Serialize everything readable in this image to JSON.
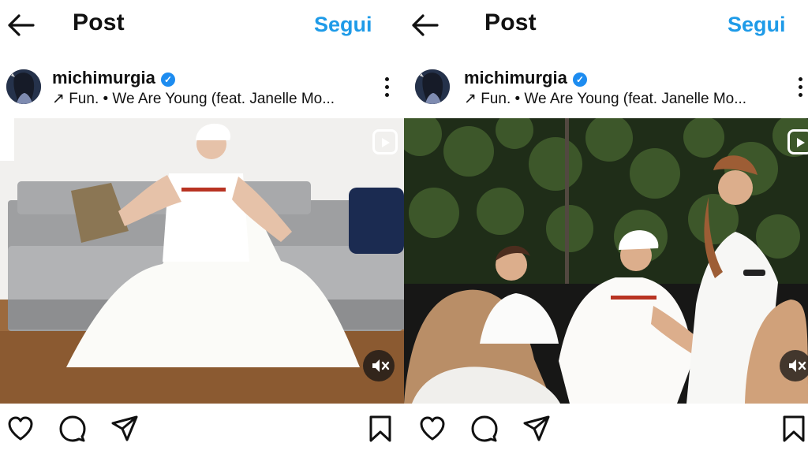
{
  "header": {
    "title": "Post",
    "follow_label": "Segui"
  },
  "post": {
    "username": "michimurgia",
    "music": "↗ Fun. • We Are Young (feat. Janelle Mo..."
  },
  "icons": [
    "back-arrow-icon",
    "verified-badge-icon",
    "more-options-icon",
    "reels-icon",
    "muted-audio-icon",
    "heart-icon",
    "comment-icon",
    "share-icon",
    "bookmark-icon"
  ],
  "colors": {
    "accent": "#1f9be8",
    "verified": "#1d8cf0"
  }
}
